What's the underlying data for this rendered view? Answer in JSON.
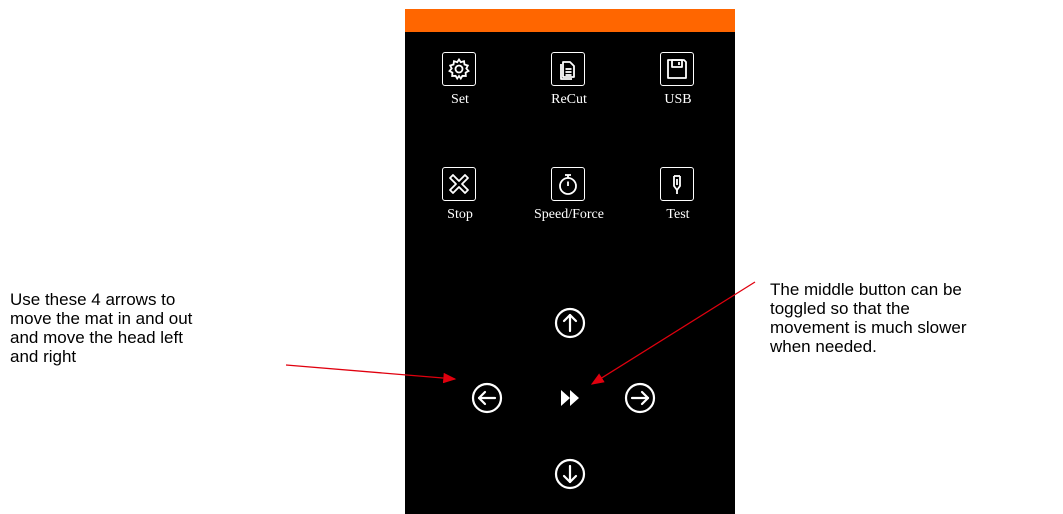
{
  "colors": {
    "accent": "#ff6600",
    "panel": "#000000",
    "icon": "#ffffff",
    "callout_line": "#e0000e"
  },
  "buttons": [
    {
      "label": "Set",
      "icon": "gear-icon"
    },
    {
      "label": "ReCut",
      "icon": "document-icon"
    },
    {
      "label": "USB",
      "icon": "floppy-icon"
    },
    {
      "label": "Stop",
      "icon": "close-x-icon"
    },
    {
      "label": "Speed/Force",
      "icon": "stopwatch-icon"
    },
    {
      "label": "Test",
      "icon": "pen-tool-icon"
    }
  ],
  "arrows": {
    "up": "arrow-up-icon",
    "left": "arrow-left-icon",
    "speed_toggle": "fast-forward-icon",
    "right": "arrow-right-icon",
    "down": "arrow-down-icon"
  },
  "notes": {
    "left": [
      "Use these 4 arrows to",
      "move the mat in and out",
      "and move the head left",
      "and right"
    ],
    "right": [
      "The middle button can be",
      "toggled so that the",
      "movement is much slower",
      "when needed."
    ]
  }
}
